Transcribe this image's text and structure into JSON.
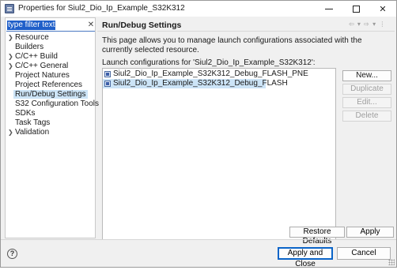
{
  "window": {
    "title": "Properties for Siul2_Dio_Ip_Example_S32K312",
    "minimize_icon": "minimize-icon",
    "maximize_icon": "maximize-icon",
    "close_glyph": "✕"
  },
  "filter": {
    "placeholder": "",
    "value": "type filter text",
    "clear_glyph": "✕"
  },
  "tree": {
    "items": [
      {
        "label": "Resource",
        "expandable": true
      },
      {
        "label": "Builders",
        "expandable": false
      },
      {
        "label": "C/C++ Build",
        "expandable": true
      },
      {
        "label": "C/C++ General",
        "expandable": true
      },
      {
        "label": "Project Natures",
        "expandable": false
      },
      {
        "label": "Project References",
        "expandable": false
      },
      {
        "label": "Run/Debug Settings",
        "expandable": false,
        "selected": true
      },
      {
        "label": "S32 Configuration Tools",
        "expandable": false
      },
      {
        "label": "SDKs",
        "expandable": false
      },
      {
        "label": "Task Tags",
        "expandable": false
      },
      {
        "label": "Validation",
        "expandable": true
      }
    ]
  },
  "page": {
    "title": "Run/Debug Settings",
    "nav_arrows": "⇦ ▾ ⇨ ▾ ⋮",
    "description": "This page allows you to manage launch configurations associated with the currently selected resource.",
    "list_label": "Launch configurations for 'Siul2_Dio_Ip_Example_S32K312':",
    "configurations": [
      {
        "label": "Siul2_Dio_Ip_Example_S32K312_Debug_FLASH_PNE",
        "selected": false
      },
      {
        "label": "Siul2_Dio_Ip_Example_S32K312_Debug_FLASH",
        "selected": true
      }
    ],
    "buttons": {
      "new": "New...",
      "duplicate": "Duplicate",
      "edit": "Edit...",
      "delete": "Delete"
    },
    "restore_defaults": "Restore Defaults",
    "apply": "Apply"
  },
  "footer": {
    "help_glyph": "?",
    "apply_and_close": "Apply and Close",
    "cancel": "Cancel"
  },
  "colors": {
    "accent": "#1f5fc9",
    "selection": "#cce4f7",
    "default_button_border": "#0a64c8"
  }
}
